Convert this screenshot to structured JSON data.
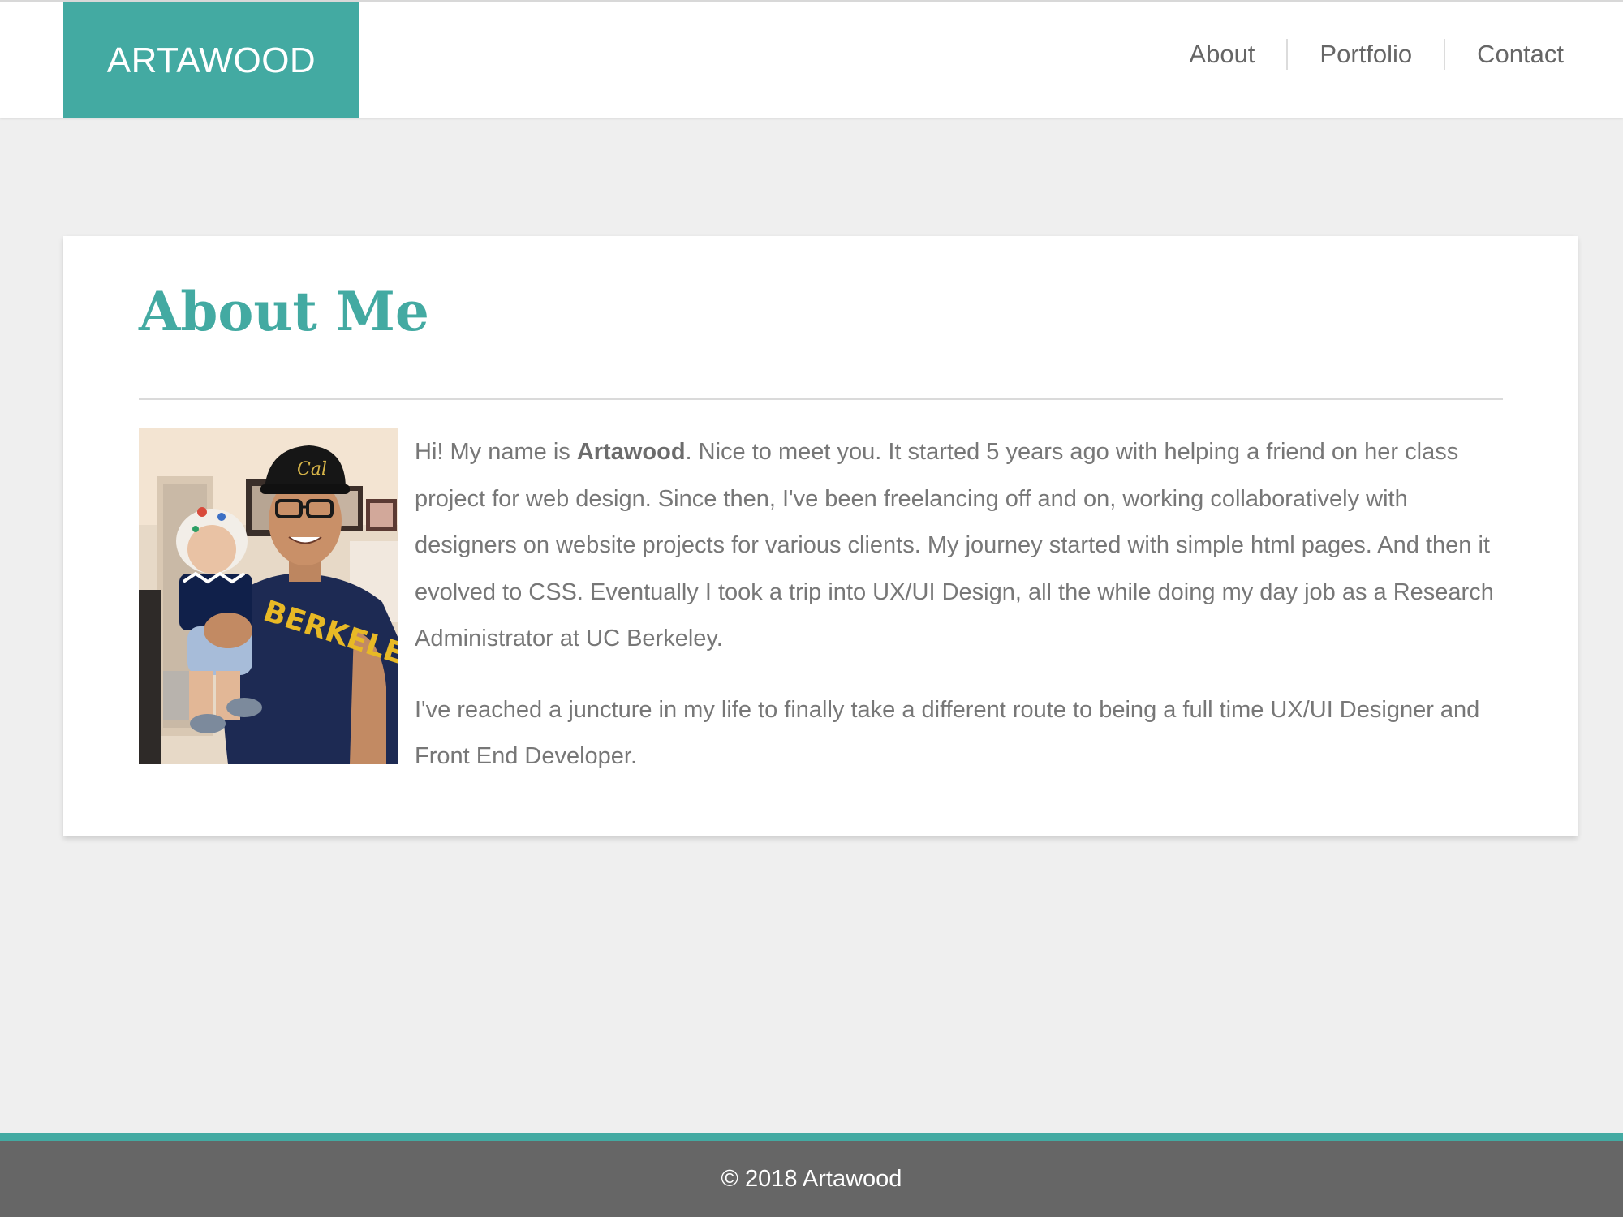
{
  "header": {
    "logo": "ARTAWOOD",
    "nav": [
      {
        "label": "About"
      },
      {
        "label": "Portfolio"
      },
      {
        "label": "Contact"
      }
    ]
  },
  "about": {
    "title": "About Me",
    "photo": {
      "shirt_text": "BERKELEY",
      "cap_text": "Cal"
    },
    "paragraph1": {
      "lead": "Hi! My name is ",
      "name": "Artawood",
      "rest": ". Nice to meet you. It started 5 years ago with helping a friend on her class project for web design. Since then, I've been freelancing off and on, working collaboratively with designers on website projects for various clients. My journey started with simple html pages. And then it evolved to CSS. Eventually I took a trip into UX/UI Design, all the while doing my day job as a Research Administrator at UC Berkeley."
    },
    "paragraph2": "I've reached a juncture in my life to finally take a different route to being a full time UX/UI Designer and Front End Developer."
  },
  "footer": {
    "copyright": "© 2018 Artawood"
  },
  "colors": {
    "accent": "#43aaa2",
    "background": "#efefef",
    "footer": "#666666",
    "body_text": "#777777"
  }
}
